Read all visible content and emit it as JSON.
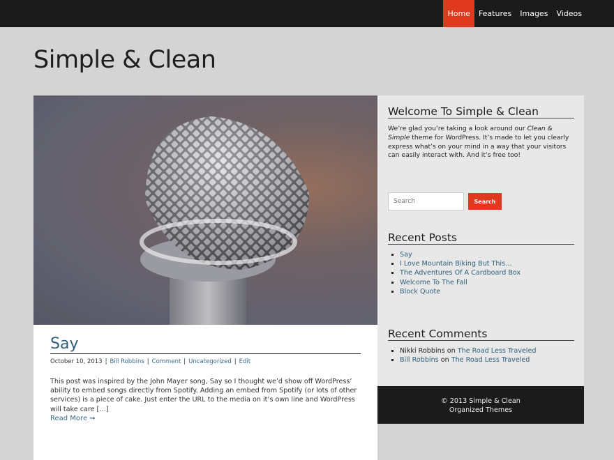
{
  "nav": {
    "items": [
      {
        "label": "Home",
        "active": true
      },
      {
        "label": "Features",
        "active": false
      },
      {
        "label": "Images",
        "active": false
      },
      {
        "label": "Videos",
        "active": false
      }
    ]
  },
  "site": {
    "title": "Simple & Clean"
  },
  "post": {
    "title": "Say",
    "date": "October 10, 2013",
    "author": "Bill Robbins",
    "comment": "Comment",
    "category": "Uncategorized",
    "edit": "Edit",
    "excerpt": "This post was inspired by the John Mayer song, Say so I thought we’d show off WordPress’ ability to embed songs directly from Spotify.  Adding an embed from Spotify (or lots of other services) is a piece of cake.  Just enter the URL to the media on it’s own line and WordPress will take care […]",
    "read_more": "Read More ➞"
  },
  "sidebar": {
    "welcome": {
      "title": "Welcome To Simple & Clean",
      "text_before": "We’re glad you’re taking a look around our ",
      "text_em": "Clean & Simple",
      "text_after": " theme for WordPress. It’s made to let you clearly express what’s on your mind in a way that your visitors can easily interact with. And it’s free too!"
    },
    "search": {
      "placeholder": "Search",
      "button": "Search"
    },
    "recent_posts": {
      "title": "Recent Posts",
      "items": [
        "Say",
        "I Love Mountain Biking But This…",
        "The Adventures Of A Cardboard Box",
        "Welcome To The Fall",
        "Block Quote"
      ]
    },
    "recent_comments": {
      "title": "Recent Comments",
      "items": [
        {
          "author": "Nikki Robbins",
          "on": "on",
          "post": "The Road Less Traveled"
        },
        {
          "author": "Bill Robbins",
          "on": "on",
          "post": "The Road Less Traveled"
        }
      ]
    }
  },
  "footer": {
    "copyright": "© 2013 Simple & Clean",
    "credit": "Organized Themes"
  }
}
